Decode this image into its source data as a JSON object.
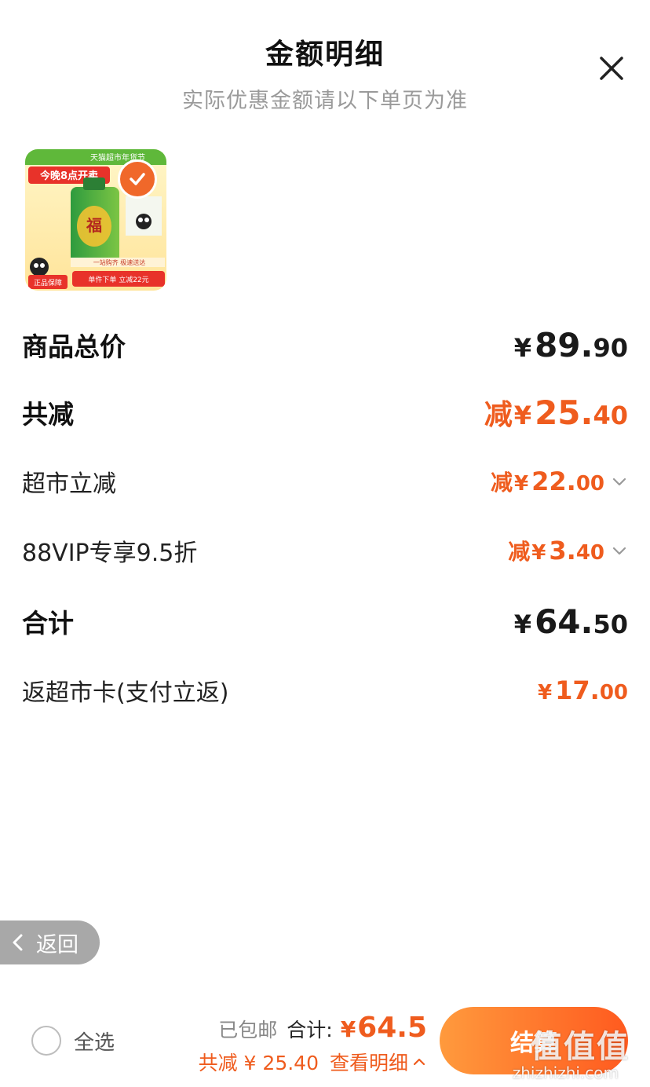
{
  "header": {
    "title": "金额明细",
    "subtitle": "实际优惠金额请以下单页为准"
  },
  "product": {
    "banner_top": "天猫超市年货节",
    "promo_main": "今晚8点开卖",
    "promo_line": "一站购齐 极速送达",
    "promo_bottom": "单件下单 立减22元",
    "guarantee": "正品保障"
  },
  "rows": {
    "goods_total": {
      "label": "商品总价",
      "currency": "¥",
      "int": "89.",
      "dec": "90"
    },
    "total_discount": {
      "label": "共减",
      "prefix": "减",
      "currency": "¥",
      "int": "25.",
      "dec": "40"
    },
    "market_discount": {
      "label": "超市立减",
      "prefix": "减",
      "currency": "¥",
      "int": "22.",
      "dec": "00"
    },
    "vip_discount": {
      "label": "88VIP专享9.5折",
      "prefix": "减",
      "currency": "¥",
      "int": "3.",
      "dec": "40"
    },
    "subtotal": {
      "label": "合计",
      "currency": "¥",
      "int": "64.",
      "dec": "50"
    },
    "card_rebate": {
      "label": "返超市卡(支付立返)",
      "currency": "¥",
      "int": "17.",
      "dec": "00"
    }
  },
  "back_button": {
    "label": "返回"
  },
  "footer": {
    "select_all": "全选",
    "free_shipping": "已包邮",
    "total_label": "合计:",
    "total_currency": "¥",
    "total_value": "64.5",
    "discount_text": "共减 ¥ 25.40",
    "view_detail": "查看明细",
    "checkout": "结算"
  },
  "watermark": {
    "main": "值值值",
    "url": "zhizhizhi.com"
  },
  "colors": {
    "accent": "#ef5c1e",
    "back_bg": "#a8a8a8"
  }
}
